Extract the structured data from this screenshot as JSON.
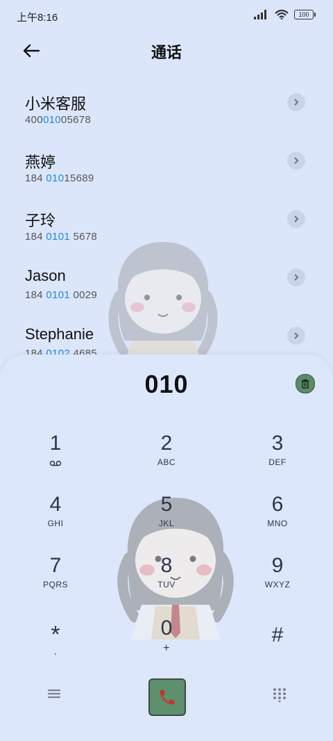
{
  "status_bar": {
    "time": "上午8:16",
    "battery": "100"
  },
  "header": {
    "title": "通话"
  },
  "contacts": [
    {
      "name": "小米客服",
      "number_pre": "400",
      "number_match": "010",
      "number_post": "05678"
    },
    {
      "name": "燕婷",
      "number_pre": "184 ",
      "number_match": "010",
      "number_post": "15689"
    },
    {
      "name": "子玲",
      "number_pre": "184 ",
      "number_match": "0101",
      "number_post": " 5678"
    },
    {
      "name": "Jason",
      "number_pre": "184 ",
      "number_match": "0101",
      "number_post": " 0029"
    },
    {
      "name": "Stephanie",
      "number_pre": "184 ",
      "number_match": "0102",
      "number_post": " 4685"
    }
  ],
  "dialer": {
    "number": "010",
    "keys": [
      {
        "digit": "1",
        "letters": ""
      },
      {
        "digit": "2",
        "letters": "ABC"
      },
      {
        "digit": "3",
        "letters": "DEF"
      },
      {
        "digit": "4",
        "letters": "GHI"
      },
      {
        "digit": "5",
        "letters": "JKL"
      },
      {
        "digit": "6",
        "letters": "MNO"
      },
      {
        "digit": "7",
        "letters": "PQRS"
      },
      {
        "digit": "8",
        "letters": "TUV"
      },
      {
        "digit": "9",
        "letters": "WXYZ"
      },
      {
        "digit": "*",
        "letters": ","
      },
      {
        "digit": "0",
        "letters": "+"
      },
      {
        "digit": "#",
        "letters": ""
      }
    ]
  },
  "colors": {
    "accent": "#1e88e5",
    "call_button": "#5e8f6e",
    "background": "#dbe6fb"
  },
  "icons": {
    "back": "arrow-left-icon",
    "chevron": "chevron-right-icon",
    "voicemail": "voicemail-icon",
    "delete": "delete-icon",
    "menu": "menu-icon",
    "call": "phone-icon",
    "keypad": "keypad-icon"
  }
}
